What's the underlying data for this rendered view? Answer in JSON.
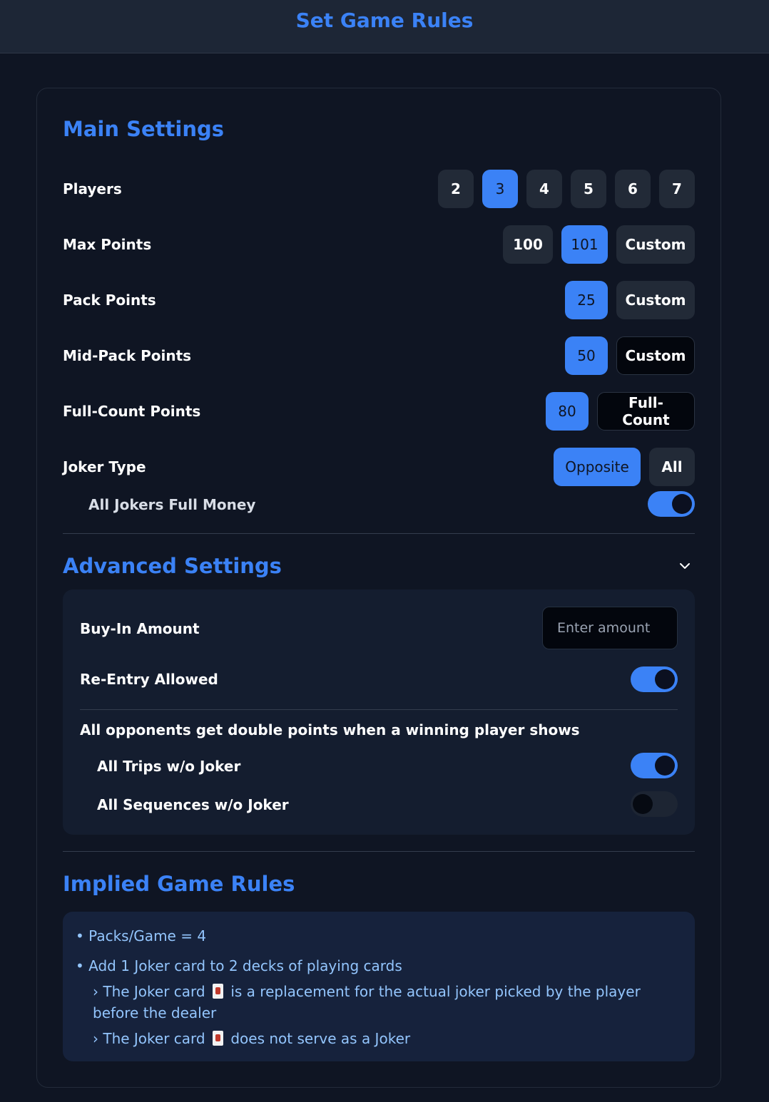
{
  "header": {
    "title": "Set Game Rules"
  },
  "main": {
    "title": "Main Settings",
    "players": {
      "label": "Players",
      "options": [
        "2",
        "3",
        "4",
        "5",
        "6",
        "7"
      ],
      "selected": "3"
    },
    "max_points": {
      "label": "Max Points",
      "options": [
        "100",
        "101",
        "Custom"
      ],
      "selected": "101"
    },
    "pack_points": {
      "label": "Pack Points",
      "options": [
        "25",
        "Custom"
      ],
      "selected": "25"
    },
    "mid_pack_points": {
      "label": "Mid-Pack Points",
      "options": [
        "50",
        "Custom"
      ],
      "selected": "50"
    },
    "full_count_points": {
      "label": "Full-Count Points",
      "options": [
        "80",
        "Full-Count"
      ],
      "selected": "80"
    },
    "joker_type": {
      "label": "Joker Type",
      "options": [
        "Opposite",
        "All"
      ],
      "selected": "Opposite"
    },
    "all_jokers_full_money": {
      "label": "All Jokers Full Money",
      "on": true
    }
  },
  "advanced": {
    "title": "Advanced Settings",
    "expanded": true,
    "buy_in": {
      "label": "Buy-In Amount",
      "placeholder": "Enter amount",
      "value": ""
    },
    "re_entry": {
      "label": "Re-Entry Allowed",
      "on": true
    },
    "double_points_heading": "All opponents get double points when a winning player shows",
    "all_trips": {
      "label": "All Trips w/o Joker",
      "on": true
    },
    "all_sequences": {
      "label": "All Sequences w/o Joker",
      "on": false
    }
  },
  "implied": {
    "title": "Implied Game Rules",
    "rule1": "• Packs/Game = 4",
    "rule2": "• Add 1 Joker card to 2 decks of playing cards",
    "rule3_prefix": "› The Joker card",
    "rule3_suffix": "is a replacement for the actual joker picked by the player before the dealer",
    "rule4_prefix": "› The Joker card",
    "rule4_suffix": "does not serve as a Joker"
  },
  "colors": {
    "accent": "#3b82f6",
    "background": "#0f1523",
    "rule_text": "#93c5fd"
  },
  "icons": {
    "chevron": "chevron-down-icon",
    "joker": "joker-card-icon"
  }
}
